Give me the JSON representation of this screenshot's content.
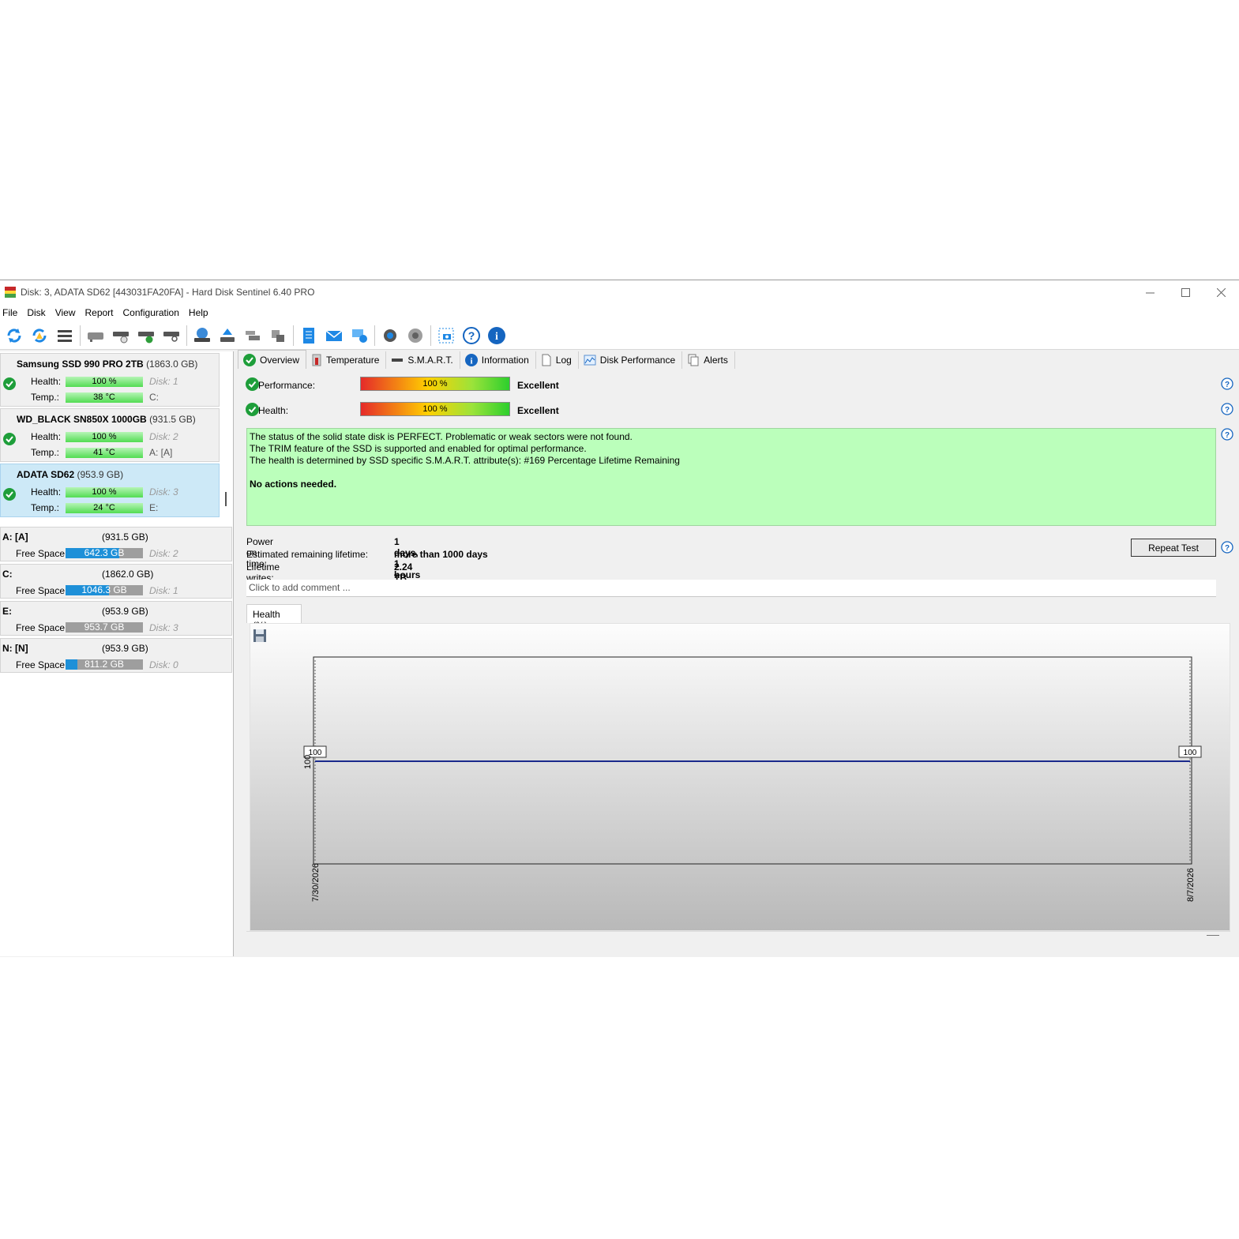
{
  "window": {
    "title": "Disk: 3, ADATA SD62 [443031FA20FA]  -  Hard Disk Sentinel 6.40 PRO"
  },
  "menu": {
    "items": [
      "File",
      "Disk",
      "View",
      "Report",
      "Configuration",
      "Help"
    ]
  },
  "disks": [
    {
      "name": "Samsung SSD 990 PRO 2TB",
      "size": "(1863.0 GB)",
      "health_label": "Health:",
      "health": "100 %",
      "disk_no": "Disk: 1",
      "temp_label": "Temp.:",
      "temp": "38 °C",
      "drive": "C:"
    },
    {
      "name": "WD_BLACK SN850X 1000GB",
      "size": "(931.5 GB)",
      "health_label": "Health:",
      "health": "100 %",
      "disk_no": "Disk: 2",
      "temp_label": "Temp.:",
      "temp": "41 °C",
      "drive": "A: [A]"
    },
    {
      "name": "ADATA SD62",
      "size": "(953.9 GB)",
      "health_label": "Health:",
      "health": "100 %",
      "disk_no": "Disk: 3",
      "temp_label": "Temp.:",
      "temp": "24 °C",
      "drive": "E:"
    }
  ],
  "volumes": [
    {
      "name": "A: [A]",
      "size": "(931.5 GB)",
      "label": "Free Space",
      "free": "642.3 GB",
      "free_fraction": 0.69,
      "disk": "Disk: 2"
    },
    {
      "name": "C:",
      "size": "(1862.0 GB)",
      "label": "Free Space",
      "free": "1046.3 GB",
      "free_fraction": 0.56,
      "disk": "Disk: 1"
    },
    {
      "name": "E:",
      "size": "(953.9 GB)",
      "label": "Free Space",
      "free": "953.7 GB",
      "free_fraction": 0.0,
      "disk": "Disk: 3"
    },
    {
      "name": "N: [N]",
      "size": "(953.9 GB)",
      "label": "Free Space",
      "free": "811.2 GB",
      "free_fraction": 0.15,
      "disk": "Disk: 0"
    }
  ],
  "tabs": [
    "Overview",
    "Temperature",
    "S.M.A.R.T.",
    "Information",
    "Log",
    "Disk Performance",
    "Alerts"
  ],
  "overview": {
    "performance_label": "Performance:",
    "performance_value": "100 %",
    "performance_rating": "Excellent",
    "health_label": "Health:",
    "health_value": "100 %",
    "health_rating": "Excellent",
    "status_lines": [
      "The status of the solid state disk is PERFECT. Problematic or weak sectors were not found.",
      "The TRIM feature of the SSD is supported and enabled for optimal performance.",
      "The health is determined by SSD specific S.M.A.R.T. attribute(s):  #169 Percentage Lifetime Remaining"
    ],
    "status_action": "No actions needed.",
    "power_on_label": "Power on time:",
    "power_on_value": "1 days, 1 hours",
    "remaining_label": "Estimated remaining lifetime:",
    "remaining_value": "more than 1000 days",
    "writes_label": "Lifetime writes:",
    "writes_value": "2.24 TB",
    "repeat_button": "Repeat Test",
    "comment_placeholder": "Click to add comment ..."
  },
  "chart_tab": "Health (%)",
  "chart_data": {
    "type": "line",
    "x": [
      "7/30/2026",
      "8/7/2026"
    ],
    "values": [
      100,
      100
    ],
    "point_labels": [
      "100",
      "100"
    ],
    "ytick": "100",
    "ylim": [
      50,
      150
    ],
    "line_color": "#1a2a8c",
    "grid": false
  },
  "colors": {
    "status_bg": "#bbffbb",
    "selected_disk": "#cde9f7",
    "free_space_fill": "#1e90d8",
    "ok_green": "#1e9e3a",
    "info_blue": "#1565c0"
  }
}
